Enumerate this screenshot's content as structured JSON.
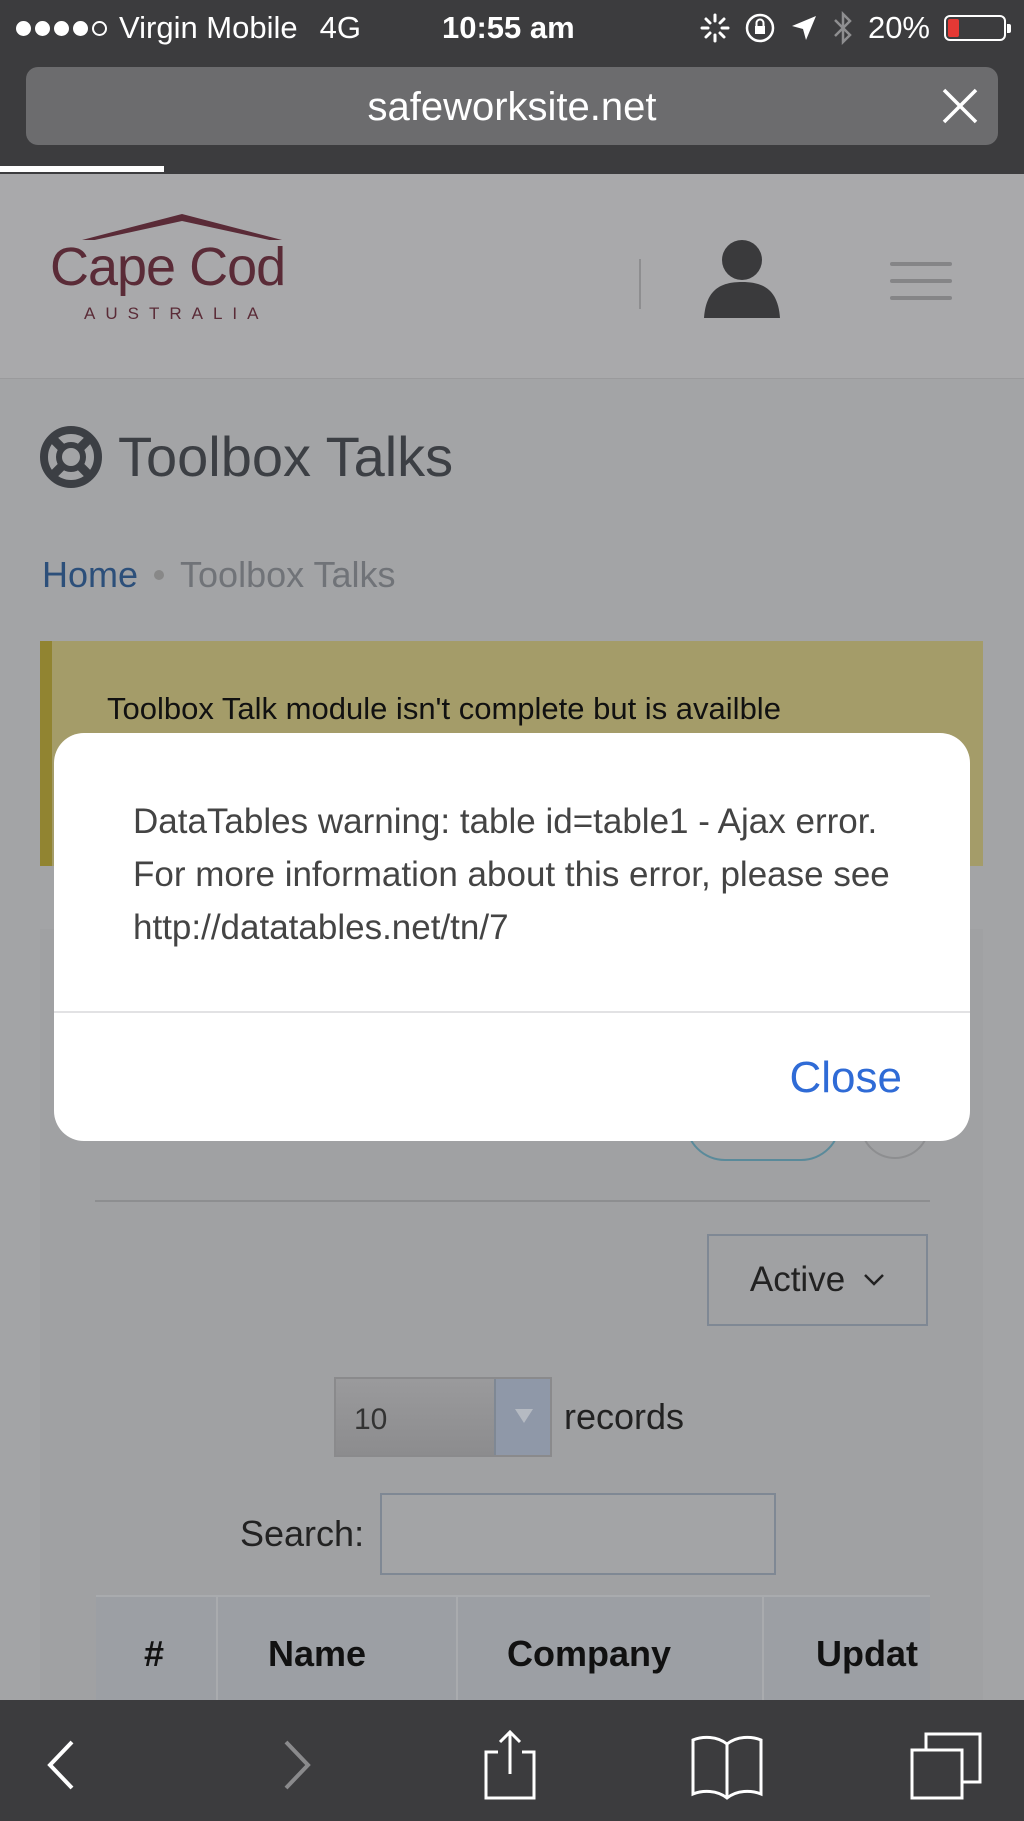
{
  "status_bar": {
    "carrier": "Virgin Mobile",
    "network": "4G",
    "time": "10:55 am",
    "battery": "20%",
    "battery_level": 0.2,
    "battery_color": "#e53935"
  },
  "browser": {
    "url": "safeworksite.net",
    "load_progress": 0.16
  },
  "site": {
    "logo_name": "Cape Cod",
    "logo_sub": "AUSTRALIA",
    "logo_color": "#5a2b37"
  },
  "page": {
    "title": "Toolbox Talks",
    "breadcrumb": {
      "home": "Home",
      "current": "Toolbox Talks"
    },
    "alert_text": "Toolbox Talk module isn't complete but is availble"
  },
  "table_controls": {
    "status_filter": "Active",
    "page_length": "10",
    "records_label": "records",
    "search_label": "Search:",
    "search_value": ""
  },
  "table": {
    "headers": [
      "#",
      "Name",
      "Company",
      "Updat"
    ]
  },
  "modal": {
    "message": "DataTables warning: table id=table1 - Ajax error. For more information about this error, please see http://datatables.net/tn/7",
    "close_label": "Close",
    "close_color": "#2f6bd6"
  }
}
